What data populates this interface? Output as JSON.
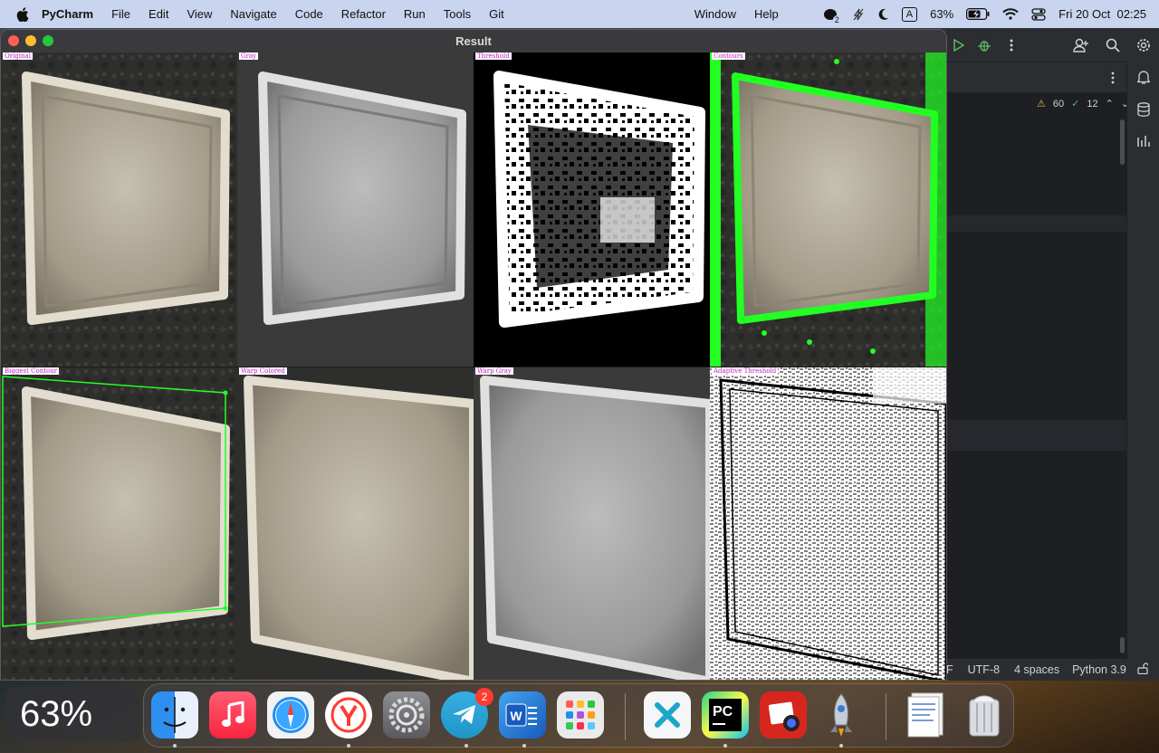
{
  "menubar": {
    "app_name": "PyCharm",
    "menus": [
      "File",
      "Edit",
      "View",
      "Navigate",
      "Code",
      "Refactor",
      "Run",
      "Tools",
      "Git"
    ],
    "window_menu": "Window",
    "help_menu": "Help",
    "status": {
      "notification_count": "2",
      "input_source": "A",
      "battery": "63%",
      "datetime": "Fri 20 Oct  02:25"
    }
  },
  "result_window": {
    "title": "Result",
    "panels": [
      {
        "label": "Original",
        "style": "color"
      },
      {
        "label": "Gray",
        "style": "gray"
      },
      {
        "label": "Threshold",
        "style": "threshold"
      },
      {
        "label": "Contours",
        "style": "contours"
      },
      {
        "label": "Biggest Contour",
        "style": "biggest"
      },
      {
        "label": "Warp Colored",
        "style": "warp-color"
      },
      {
        "label": "Warp Gray",
        "style": "warp-gray"
      },
      {
        "label": "Adaptive Threshold",
        "style": "adaptive"
      }
    ]
  },
  "ide": {
    "inspections": {
      "warnings": "60",
      "ok": "12"
    },
    "statusbar": {
      "line_sep_fragment": "F",
      "encoding": "UTF-8",
      "indent": "4 spaces",
      "interpreter": "Python 3.9"
    }
  },
  "hud": {
    "volume": "63%"
  },
  "dock": {
    "apps": [
      "Finder",
      "Music",
      "Safari",
      "Yandex Browser",
      "System Settings",
      "Telegram",
      "Microsoft Word",
      "Launchpad",
      "Xcode Helper",
      "PyCharm",
      "Photo Booth",
      "Rocket Typist",
      "Documents",
      "Trash"
    ],
    "telegram_badge": "2"
  },
  "colors": {
    "menubar": "#c9d4ee",
    "ide_bg": "#1e1f22",
    "label_text": "#c41bc4",
    "contour_green": "#22ff22"
  }
}
